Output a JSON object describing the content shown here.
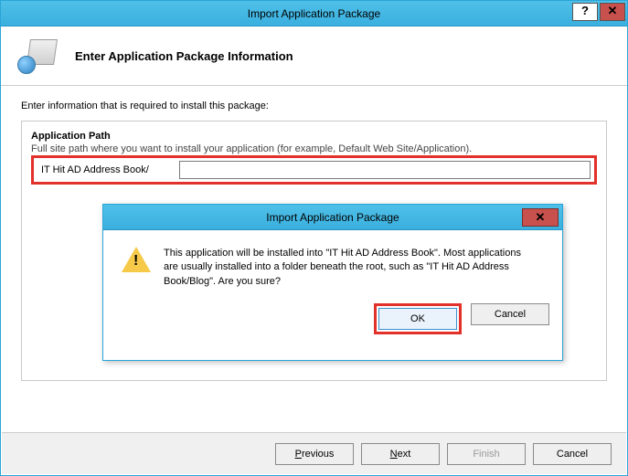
{
  "window": {
    "title": "Import Application Package"
  },
  "header": {
    "title": "Enter Application Package Information"
  },
  "body": {
    "instruction": "Enter information that is required to install this package:"
  },
  "group": {
    "title": "Application Path",
    "description": "Full site path where you want to install your application (for example, Default Web Site/Application).",
    "path_label": "IT Hit AD Address Book/",
    "path_value": ""
  },
  "inner_dialog": {
    "title": "Import Application Package",
    "message": "This application will be installed into \"IT Hit AD Address Book\". Most applications are usually installed into a folder beneath the root, such as \"IT Hit AD Address Book/Blog\". Are you sure?",
    "ok_label": "OK",
    "cancel_label": "Cancel"
  },
  "buttons": {
    "previous": "Previous",
    "next": "Next",
    "finish": "Finish",
    "cancel": "Cancel"
  }
}
